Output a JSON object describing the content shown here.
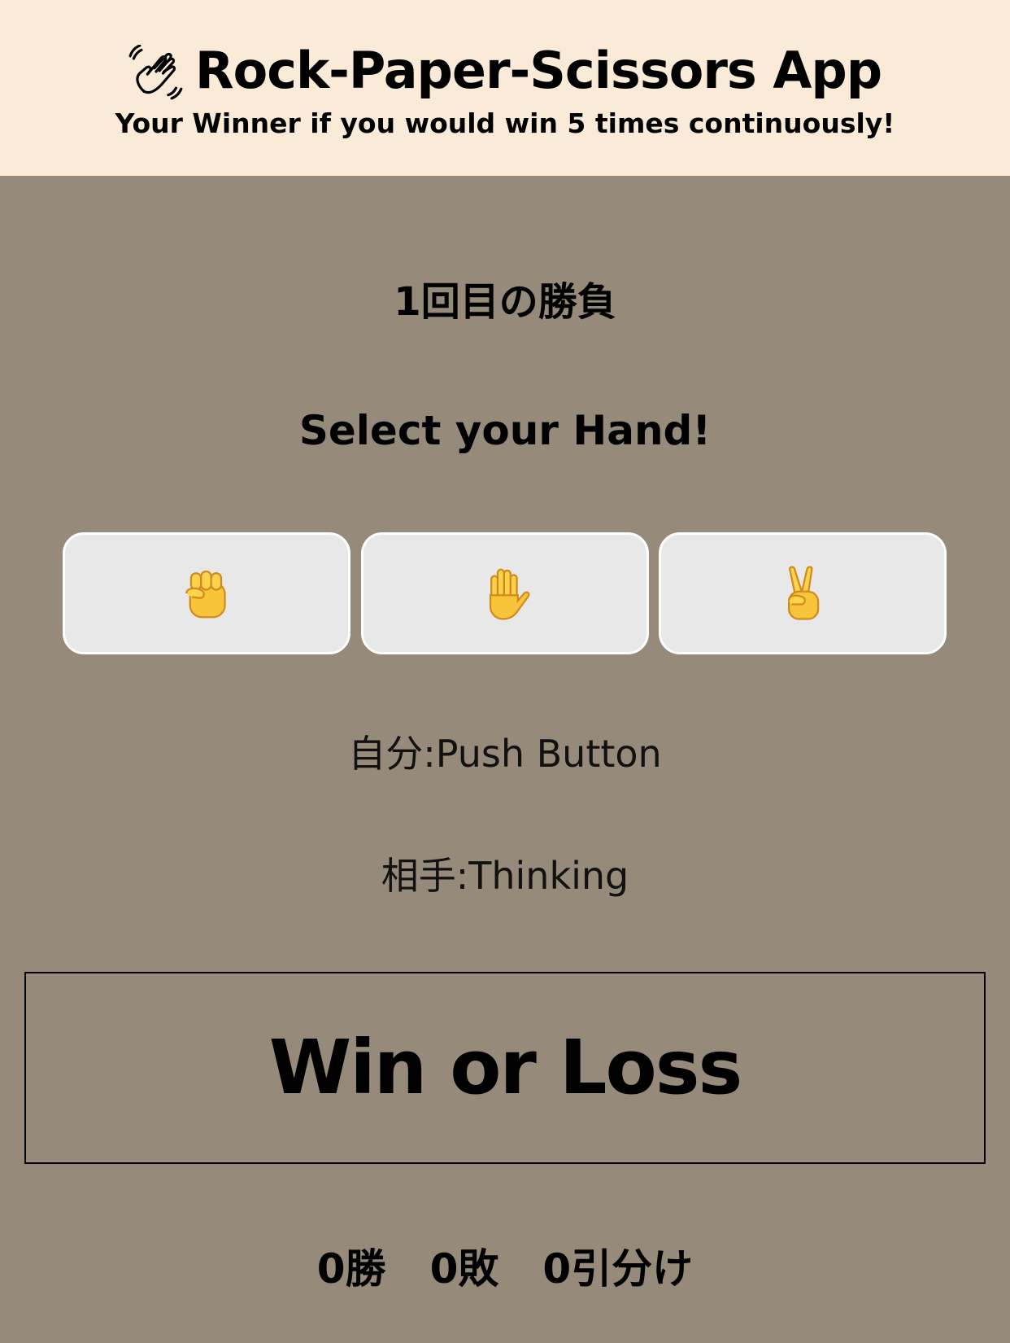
{
  "header": {
    "title": "Rock-Paper-Scissors App",
    "subtitle": "Your Winner if you would win 5 times continuously!",
    "icon": "waving-hand-icon"
  },
  "game": {
    "round_label": "1回目の勝負",
    "prompt": "Select your Hand!",
    "hands": [
      {
        "name": "rock",
        "icon": "raised-fist-icon"
      },
      {
        "name": "paper",
        "icon": "raised-hand-icon"
      },
      {
        "name": "scissors",
        "icon": "victory-hand-icon"
      }
    ],
    "self_status": "自分:Push Button",
    "opponent_status": "相手:Thinking",
    "result": "Win or Loss"
  },
  "score": {
    "wins": "0勝",
    "losses": "0敗",
    "draws": "0引分け"
  },
  "colors": {
    "header_bg": "#faebd8",
    "page_bg": "#968b7b",
    "button_bg": "#e8e8e8",
    "emoji_yellow": "#f8c53a"
  }
}
